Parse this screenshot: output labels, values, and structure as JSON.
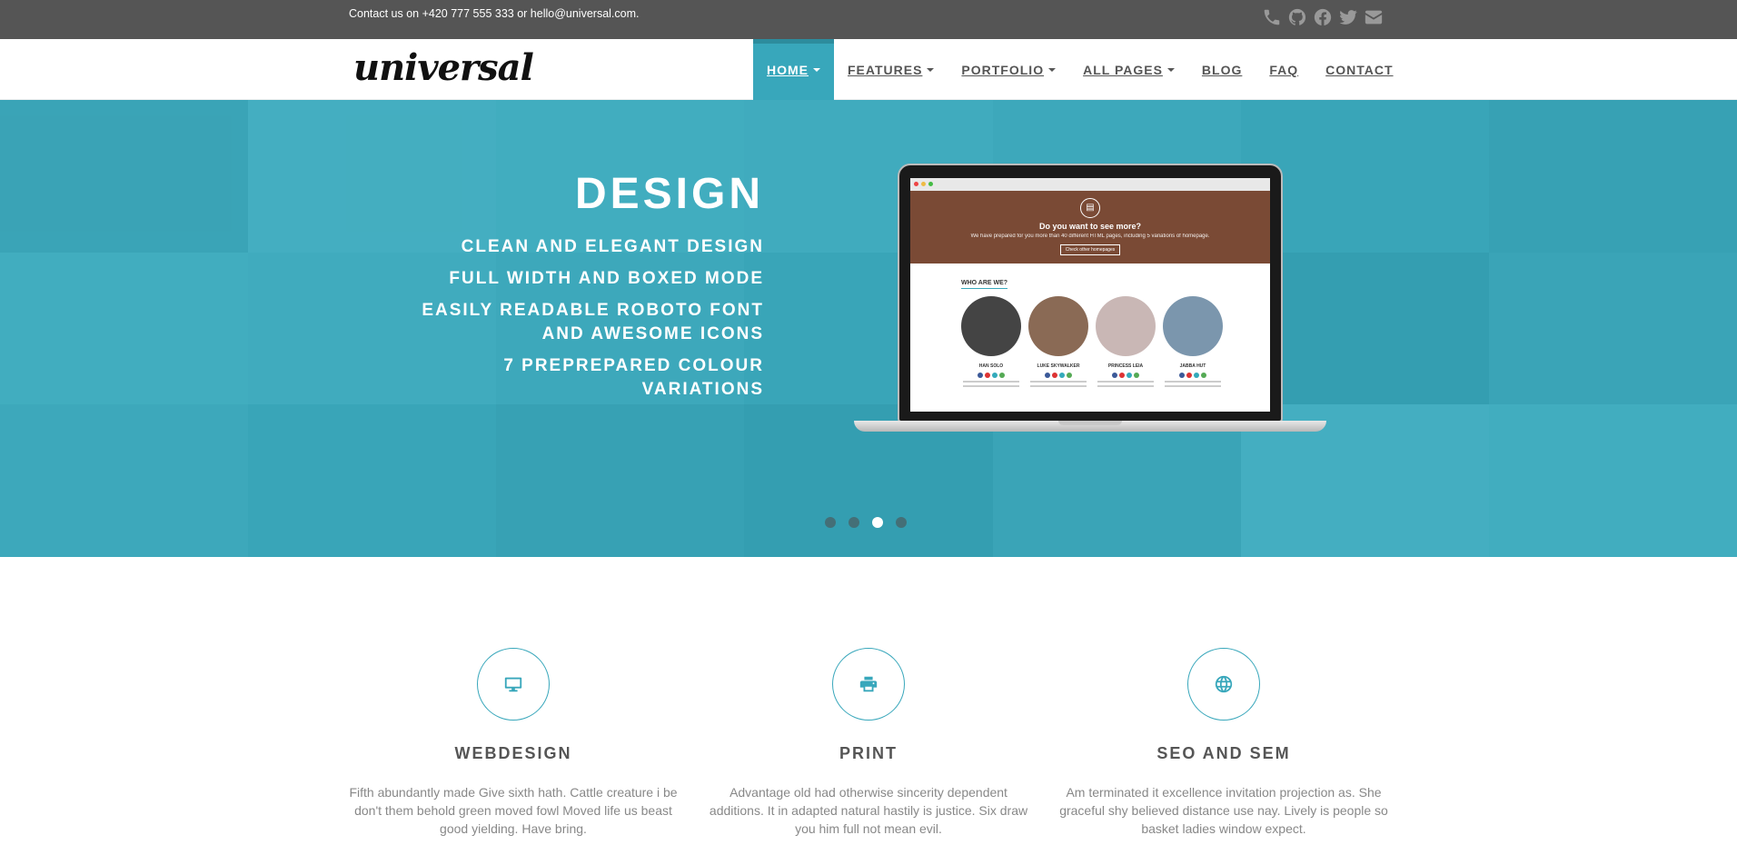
{
  "topbar": {
    "contact_text": "Contact us on +420 777 555 333 or hello@universal.com.",
    "socials": [
      "phone-icon",
      "github-icon",
      "facebook-icon",
      "twitter-icon",
      "email-icon"
    ]
  },
  "navbar": {
    "logo": "universal",
    "items": [
      {
        "label": "HOME",
        "dropdown": true,
        "active": true
      },
      {
        "label": "FEATURES",
        "dropdown": true,
        "active": false
      },
      {
        "label": "PORTFOLIO",
        "dropdown": true,
        "active": false
      },
      {
        "label": "ALL PAGES",
        "dropdown": true,
        "active": false
      },
      {
        "label": "BLOG",
        "dropdown": false,
        "active": false
      },
      {
        "label": "FAQ",
        "dropdown": false,
        "active": false
      },
      {
        "label": "CONTACT",
        "dropdown": false,
        "active": false
      }
    ]
  },
  "hero": {
    "title": "DESIGN",
    "lines": [
      "CLEAN AND ELEGANT DESIGN",
      "FULL WIDTH AND BOXED MODE",
      "EASILY READABLE ROBOTO FONT AND AWESOME ICONS",
      "7 PREPREPARED COLOUR VARIATIONS"
    ],
    "laptop_screen": {
      "heading": "Do you want to see more?",
      "subtext": "We have prepared for you more than 40 different HTML pages, including 5 variations of homepage.",
      "button": "Check other homepages",
      "section_title": "WHO ARE WE?",
      "people": [
        "HAN SOLO",
        "LUKE SKYWALKER",
        "PRINCESS LEIA",
        "JABBA HUT"
      ]
    },
    "slider": {
      "count": 4,
      "active_index": 2
    }
  },
  "services": [
    {
      "icon": "desktop-icon",
      "title": "WEBDESIGN",
      "text": "Fifth abundantly made Give sixth hath. Cattle creature i be don't them behold green moved fowl Moved life us beast good yielding. Have bring."
    },
    {
      "icon": "print-icon",
      "title": "PRINT",
      "text": "Advantage old had otherwise sincerity dependent additions. It in adapted natural hastily is justice. Six draw you him full not mean evil."
    },
    {
      "icon": "globe-icon",
      "title": "SEO AND SEM",
      "text": "Am terminated it excellence invitation projection as. She graceful shy believed distance use nay. Lively is people so basket ladies window expect."
    }
  ],
  "colors": {
    "accent": "#38a7bb",
    "topbar": "#555555",
    "text": "#555555"
  }
}
